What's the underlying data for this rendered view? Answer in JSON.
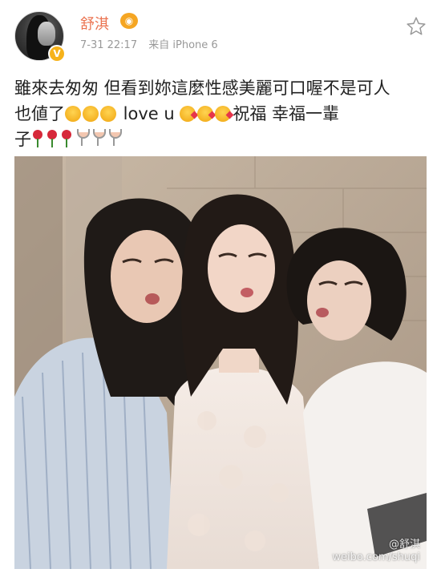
{
  "header": {
    "username": "舒淇",
    "timestamp": "7-31 22:17",
    "source": "来自 iPhone 6"
  },
  "post": {
    "text_line1": "雖來去匆匆 但看到妳這麼性感美麗可口喔不是可人",
    "text_line2_prefix": "也値了",
    "love_text": " love u ",
    "bless_text": "祝福 幸福一輩",
    "text_line3_prefix": "子"
  },
  "photo": {
    "watermark_name": "@舒淇",
    "watermark_url": "weibo.com/shuqi"
  },
  "icons": {
    "star": "star-icon",
    "verified": "verified-badge",
    "vip": "vip-badge"
  },
  "colors": {
    "username": "#eb7350",
    "meta": "#999999",
    "text": "#222222"
  }
}
